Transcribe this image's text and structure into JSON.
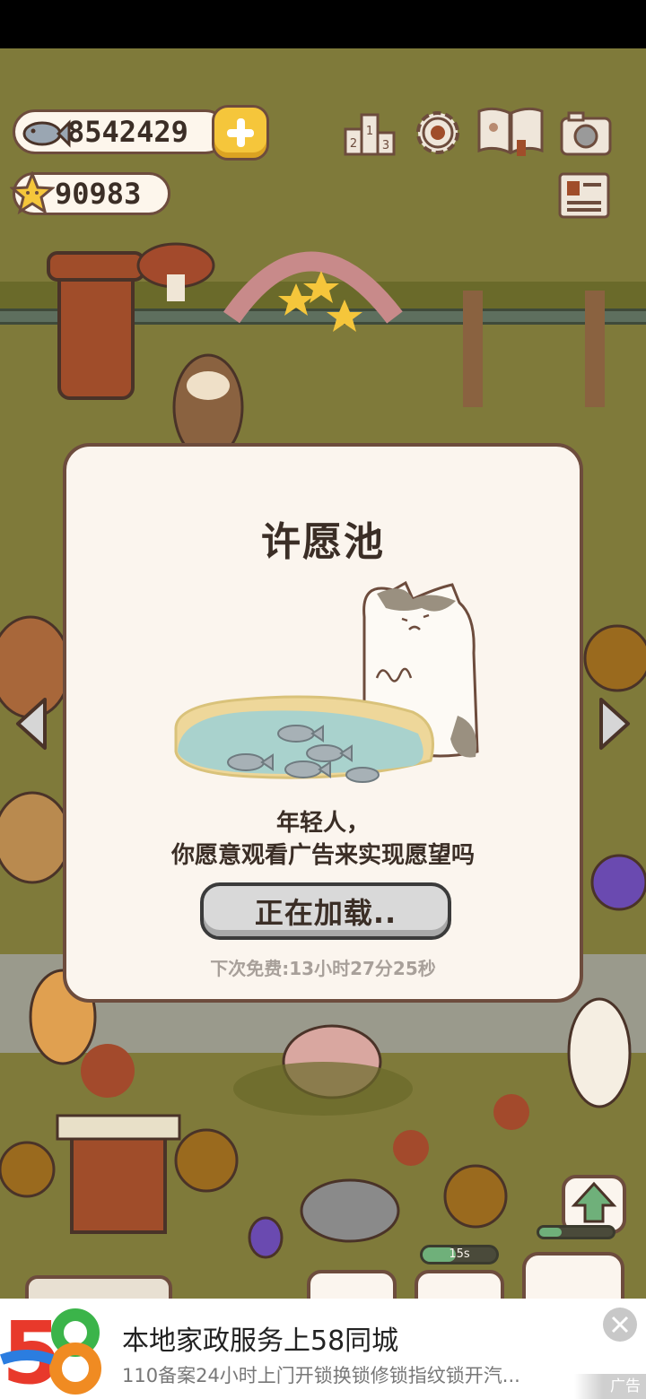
{
  "hud": {
    "fish_amount": "8542429",
    "star_amount": "90983"
  },
  "dialog": {
    "title": "许愿池",
    "prompt_line1": "年轻人，",
    "prompt_line2": "你愿意观看广告来实现愿望吗",
    "button_label": "正在加载..",
    "timer_text": "下次免费:13小时27分25秒"
  },
  "indicators": {
    "progress_label": "15s",
    "progress_fraction": 0.45
  },
  "ad": {
    "logo_text_1": "5",
    "logo_text_2": "8",
    "title": "本地家政服务上58同城",
    "description": "110备案24小时上门开锁换锁修锁指纹锁开汽...",
    "label": "广告"
  },
  "icons": {
    "fish": "fish-icon",
    "star": "star-icon",
    "plus": "plus-icon",
    "ranking": "podium-icon",
    "settings": "gear-icon",
    "book": "book-icon",
    "camera": "camera-icon",
    "news": "newspaper-icon",
    "left": "left-arrow-icon",
    "right": "right-arrow-icon",
    "upgrade": "upgrade-arrow-icon",
    "close": "close-icon"
  },
  "colors": {
    "dialog_bg": "#fbf5ee",
    "outline": "#6d4c3d",
    "accent_yellow": "#f5c63b",
    "button_gray": "#d9d9d9"
  }
}
